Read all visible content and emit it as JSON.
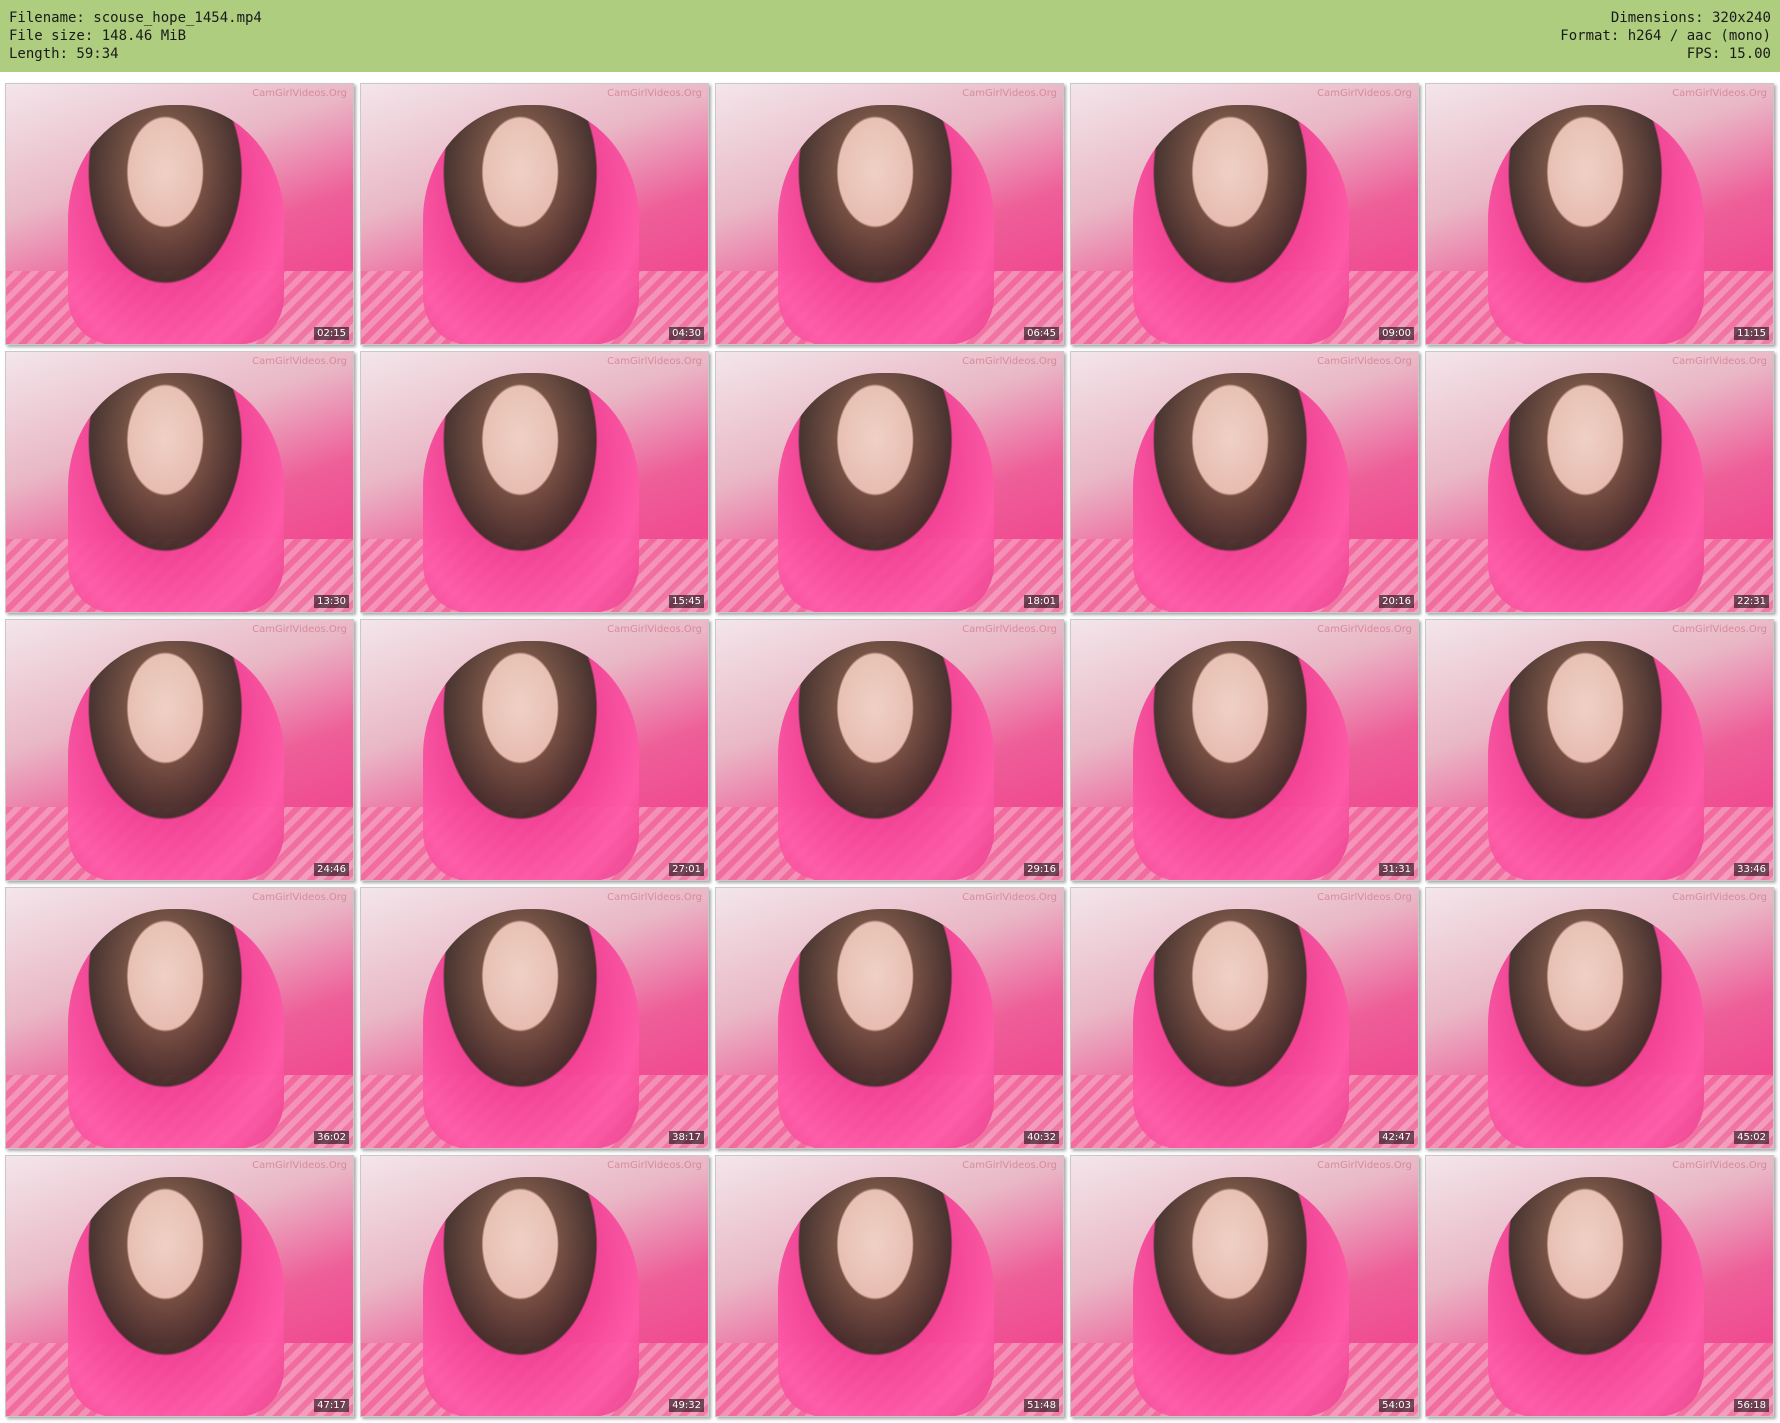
{
  "header": {
    "filename_line": "Filename: scouse_hope_1454.mp4",
    "filesize_line": "File size: 148.46 MiB",
    "length_line": "Length: 59:34",
    "dimensions_line": "Dimensions: 320x240",
    "format_line": "Format: h264 / aac (mono)",
    "fps_line": "FPS: 15.00"
  },
  "watermark": "CamGirlVideos.Org",
  "thumbnails": [
    {
      "timestamp": "02:15"
    },
    {
      "timestamp": "04:30"
    },
    {
      "timestamp": "06:45"
    },
    {
      "timestamp": "09:00"
    },
    {
      "timestamp": "11:15"
    },
    {
      "timestamp": "13:30"
    },
    {
      "timestamp": "15:45"
    },
    {
      "timestamp": "18:01"
    },
    {
      "timestamp": "20:16"
    },
    {
      "timestamp": "22:31"
    },
    {
      "timestamp": "24:46"
    },
    {
      "timestamp": "27:01"
    },
    {
      "timestamp": "29:16"
    },
    {
      "timestamp": "31:31"
    },
    {
      "timestamp": "33:46"
    },
    {
      "timestamp": "36:02"
    },
    {
      "timestamp": "38:17"
    },
    {
      "timestamp": "40:32"
    },
    {
      "timestamp": "42:47"
    },
    {
      "timestamp": "45:02"
    },
    {
      "timestamp": "47:17"
    },
    {
      "timestamp": "49:32"
    },
    {
      "timestamp": "51:48"
    },
    {
      "timestamp": "54:03"
    },
    {
      "timestamp": "56:18"
    }
  ],
  "colors": {
    "header_bg": "#aecd7f",
    "accent_pink": "#f04a90"
  }
}
